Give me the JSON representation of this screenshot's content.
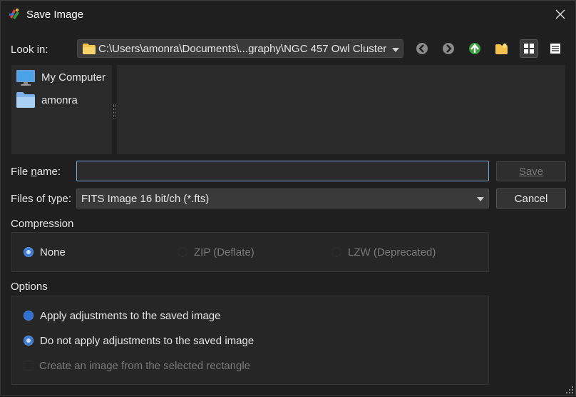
{
  "window": {
    "title": "Save Image",
    "close_icon": "close-icon",
    "app_icon": "app-logo-icon"
  },
  "look_in": {
    "label": "Look in:",
    "path": "C:\\Users\\amonra\\Documents\\...graphy\\NGC 457 Owl Cluster",
    "nav_icons": [
      "back-arrow-icon",
      "forward-arrow-icon",
      "up-arrow-icon",
      "new-folder-icon",
      "list-view-icon",
      "detail-view-icon"
    ]
  },
  "sidebar": {
    "items": [
      {
        "label": "My Computer",
        "icon": "computer-icon"
      },
      {
        "label": "amonra",
        "icon": "folder-icon"
      }
    ]
  },
  "file_name": {
    "label": "File name:",
    "value": "",
    "placeholder": ""
  },
  "files_of_type": {
    "label": "Files of type:",
    "value": "FITS Image 16 bit/ch (*.fts)"
  },
  "buttons": {
    "save": "Save",
    "cancel": "Cancel"
  },
  "compression": {
    "title": "Compression",
    "options": [
      {
        "label": "None",
        "checked": true,
        "enabled": true
      },
      {
        "label": "ZIP (Deflate)",
        "checked": false,
        "enabled": false
      },
      {
        "label": "LZW (Deprecated)",
        "checked": false,
        "enabled": false
      }
    ]
  },
  "options": {
    "title": "Options",
    "apply": "Apply adjustments to the saved image",
    "do_not_apply": "Do not apply adjustments to the saved image",
    "create_from_rect": "Create an image from the selected rectangle"
  },
  "colors": {
    "accent": "#3a7bd5",
    "background": "#1f1f1f",
    "panel": "#2a2a2a"
  }
}
